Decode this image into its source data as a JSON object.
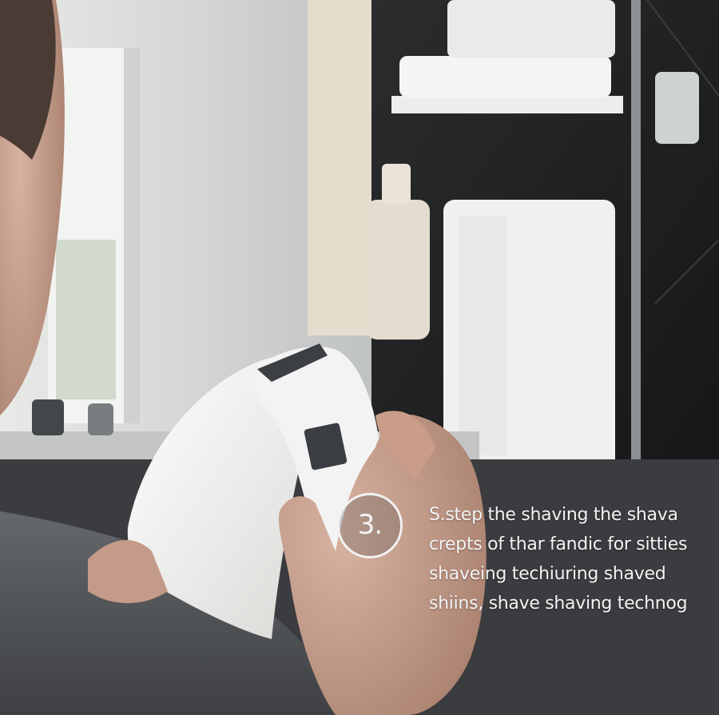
{
  "step": {
    "number": "3.",
    "caption_lines": [
      "S.step the shaving the shava",
      "crepts of thar fandic for sitties",
      "shaveing techiuring shaved",
      "shiins, shave shaving technog"
    ]
  },
  "colors": {
    "wall_dark": "#1e2022",
    "towel_white": "#f1f1ef",
    "shirt_grey": "#55585c",
    "skin": "#c9a391",
    "text": "#f3f3f3"
  },
  "icons": {
    "step_badge": "circle-outline"
  }
}
